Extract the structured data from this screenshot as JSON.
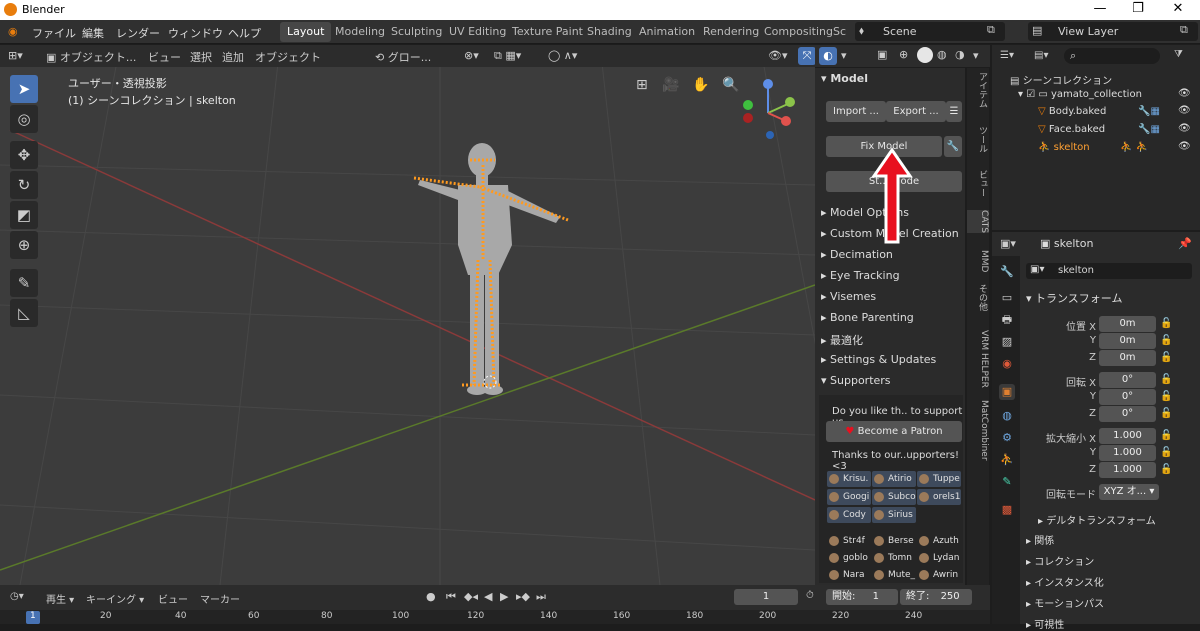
{
  "window": {
    "title": "Blender"
  },
  "menu": [
    "ファイル",
    "編集",
    "レンダー",
    "ウィンドウ",
    "ヘルプ"
  ],
  "workspaces": [
    "Layout",
    "Modeling",
    "Sculpting",
    "UV Editing",
    "Texture Paint",
    "Shading",
    "Animation",
    "Rendering",
    "Compositing",
    "Sc"
  ],
  "scene": "Scene",
  "view_layer": "View Layer",
  "viewport": {
    "mode": "オブジェクト...",
    "menus": [
      "ビュー",
      "選択",
      "追加",
      "オブジェクト"
    ],
    "orientation": "グロー...",
    "overlay_title": "ユーザー・透視投影",
    "overlay_sub": "(1) シーンコレクション | skelton"
  },
  "npanel": {
    "header": "Model",
    "import": "Import ...",
    "export": "Export ...",
    "fix_model": "Fix Model",
    "start_pose": "St... Mode",
    "sections": [
      "Model Options",
      "Custom Model Creation",
      "Decimation",
      "Eye Tracking",
      "Visemes",
      "Bone Parenting",
      "最適化",
      "Settings & Updates",
      "Supporters"
    ],
    "support_text": "Do you like th.. to support us",
    "patron": "Become a Patron",
    "thanks": "Thanks to our..upporters! <3",
    "supporters": [
      [
        "Krisu.",
        "Atirio",
        "Tuppe"
      ],
      [
        "Googi",
        "Subco",
        "orels1"
      ],
      [
        "Cody",
        "Sirius"
      ]
    ],
    "supporters2": [
      [
        "Str4f",
        "Berse",
        "Azuth"
      ],
      [
        "goblo",
        "Tomn",
        "Lydan"
      ],
      [
        "Nara",
        "Mute_",
        "Awrin"
      ]
    ],
    "tabs": [
      "アイテム",
      "ツール",
      "ビュー",
      "CATS",
      "MMD",
      "その他",
      "VRM HELPER",
      "MatCombiner"
    ]
  },
  "outliner": {
    "root": "シーンコレクション",
    "collection": "yamato_collection",
    "items": [
      "Body.baked",
      "Face.baked",
      "skelton"
    ]
  },
  "properties": {
    "object": "skelton",
    "name": "skelton",
    "transform": "トランスフォーム",
    "location_label": "位置 X",
    "rotation_label": "回転 X",
    "scale_label": "拡大縮小 X",
    "axes": [
      "Y",
      "Z"
    ],
    "location": [
      "0m",
      "0m",
      "0m"
    ],
    "rotation": [
      "0°",
      "0°",
      "0°"
    ],
    "scale": [
      "1.000",
      "1.000",
      "1.000"
    ],
    "rotation_mode_label": "回転モード",
    "rotation_mode": "XYZ オ...",
    "delta": "デルタトランスフォーム",
    "sections": [
      "関係",
      "コレクション",
      "インスタンス化",
      "モーションパス",
      "可視性"
    ]
  },
  "timeline": {
    "menus": [
      "再生",
      "キーイング",
      "ビュー",
      "マーカー"
    ],
    "current_frame": "1",
    "start_label": "開始:",
    "start": "1",
    "end_label": "終了:",
    "end": "250",
    "ticks": [
      "1",
      "20",
      "40",
      "60",
      "80",
      "100",
      "120",
      "140",
      "160",
      "180",
      "200",
      "220",
      "240"
    ]
  },
  "colors": {
    "accent": "#4772b3",
    "bone": "#ff9a1f",
    "arrow": "#e8101f"
  }
}
